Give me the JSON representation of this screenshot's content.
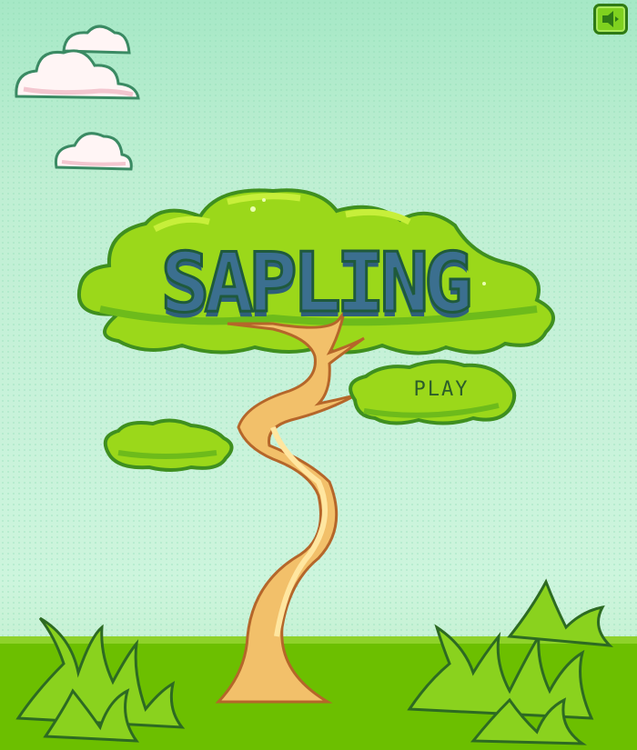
{
  "game": {
    "title": "SAPLING",
    "play_label": "PLAY"
  },
  "icons": {
    "sound": "sound-toggle-icon"
  },
  "colors": {
    "sky": "#a6e8c6",
    "ground": "#6cbf00",
    "foliage": "#9bd81a",
    "foliage_outline": "#3f8f1f",
    "trunk": "#f2c06a",
    "title": "#3b6f8f"
  }
}
